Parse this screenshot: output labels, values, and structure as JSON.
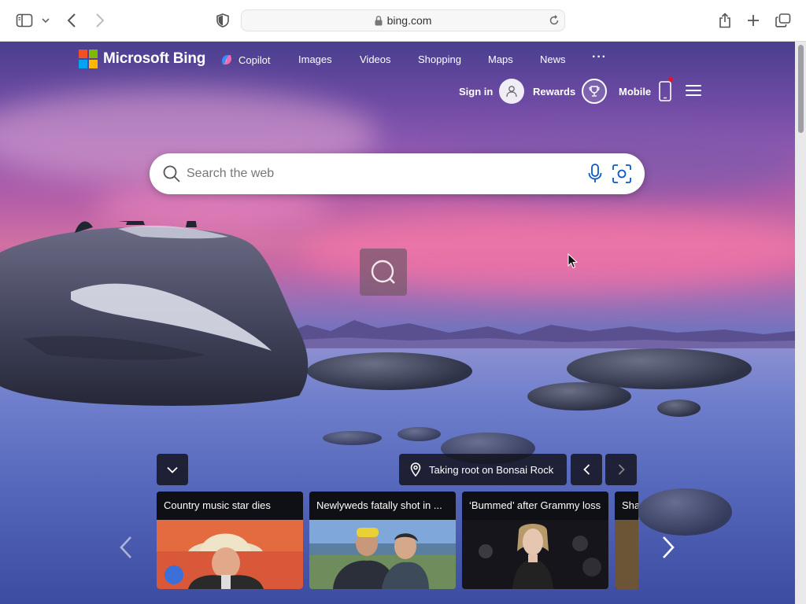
{
  "browser": {
    "url": "bing.com"
  },
  "header": {
    "brand": "Microsoft Bing",
    "nav": [
      {
        "label": "Copilot"
      },
      {
        "label": "Images"
      },
      {
        "label": "Videos"
      },
      {
        "label": "Shopping"
      },
      {
        "label": "Maps"
      },
      {
        "label": "News"
      }
    ],
    "more": "···",
    "sign_in": "Sign in",
    "rewards": "Rewards",
    "mobile": "Mobile"
  },
  "search": {
    "placeholder": "Search the web"
  },
  "image_of_day": {
    "location": "Taking root on Bonsai Rock"
  },
  "news": [
    {
      "title": "Country music star dies"
    },
    {
      "title": "Newlyweds fatally shot in ..."
    },
    {
      "title": "‘Bummed’ after Grammy loss"
    },
    {
      "title": "Sha"
    }
  ],
  "colors": {
    "ms_red": "#f25022",
    "ms_green": "#7fba00",
    "ms_blue": "#00a4ef",
    "ms_yellow": "#ffb900"
  }
}
